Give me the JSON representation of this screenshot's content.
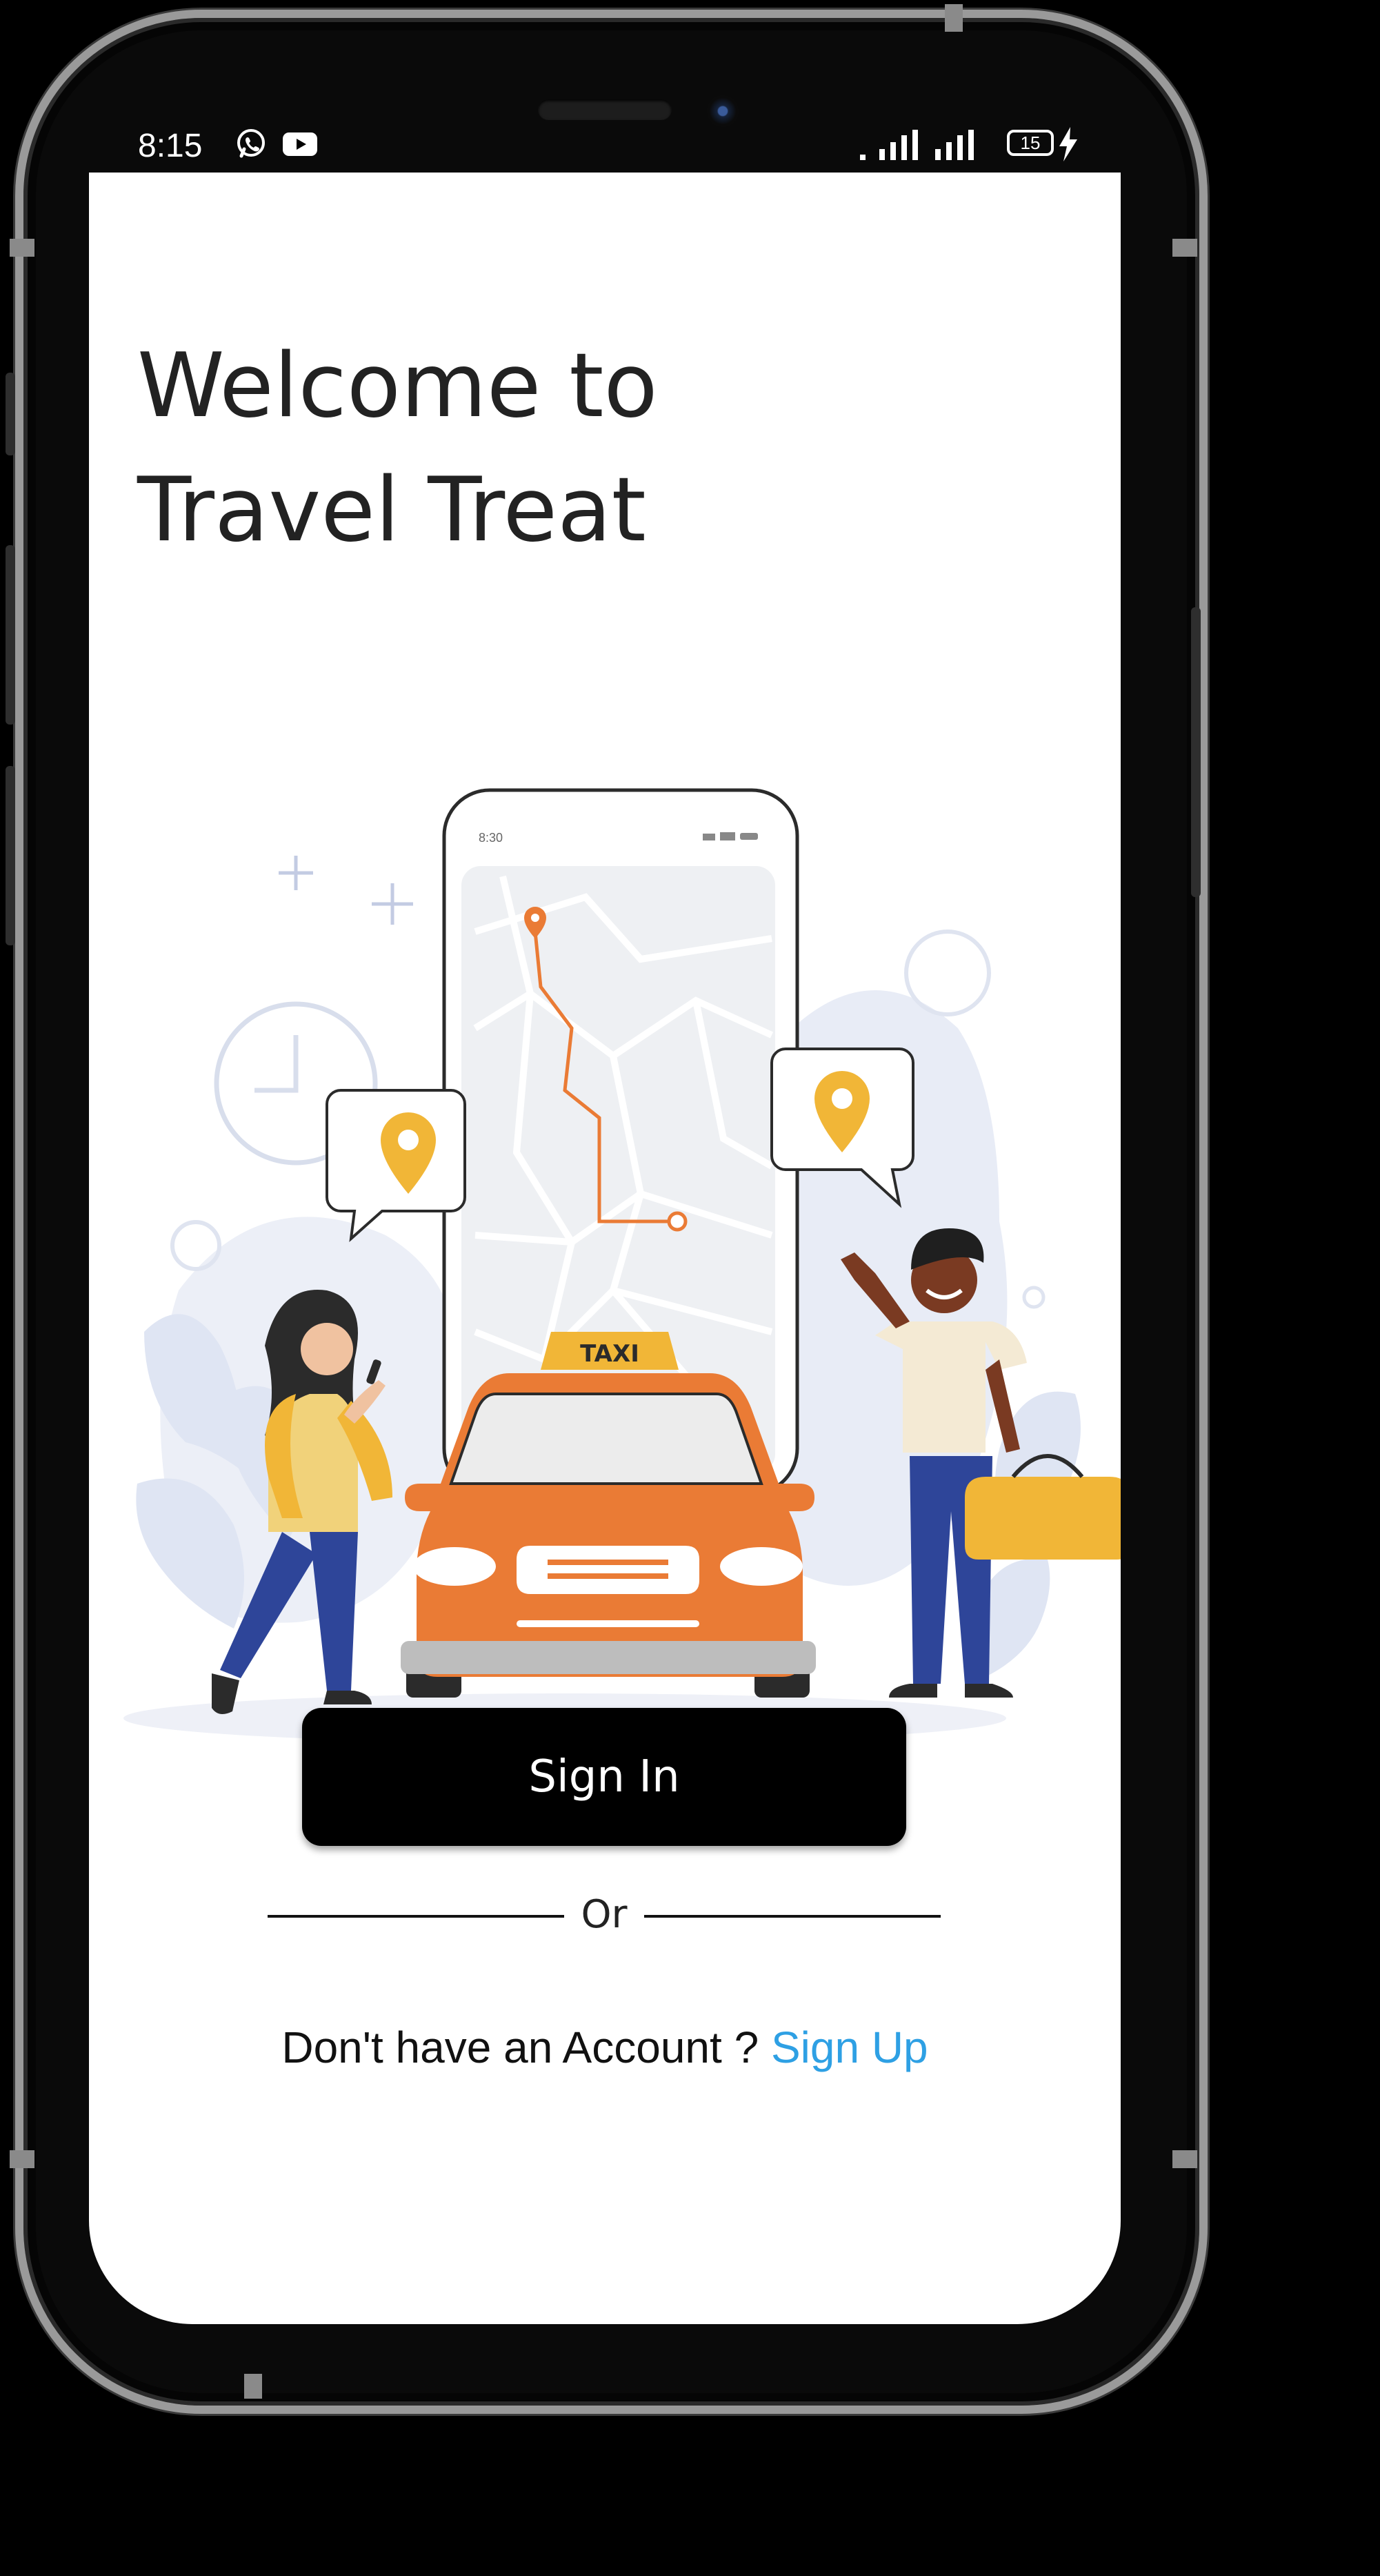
{
  "status_bar": {
    "time": "8:15",
    "battery": "15",
    "icons": [
      "whatsapp-icon",
      "youtube-icon",
      "signal-icon",
      "signal-icon",
      "battery-icon",
      "charging-icon"
    ]
  },
  "welcome": {
    "line1": "Welcome to",
    "line2": "Travel Treat"
  },
  "illustration": {
    "phone_time": "8:30",
    "taxi_sign": "TAXI"
  },
  "actions": {
    "sign_in_label": "Sign In",
    "or_label": "Or",
    "no_account_text": "Don't have an Account ?",
    "sign_up_label": "Sign Up"
  },
  "colors": {
    "accent_link": "#2ea0e4",
    "taxi_orange": "#ea7b35",
    "pin_yellow": "#f1b637",
    "button_bg": "#000000"
  }
}
